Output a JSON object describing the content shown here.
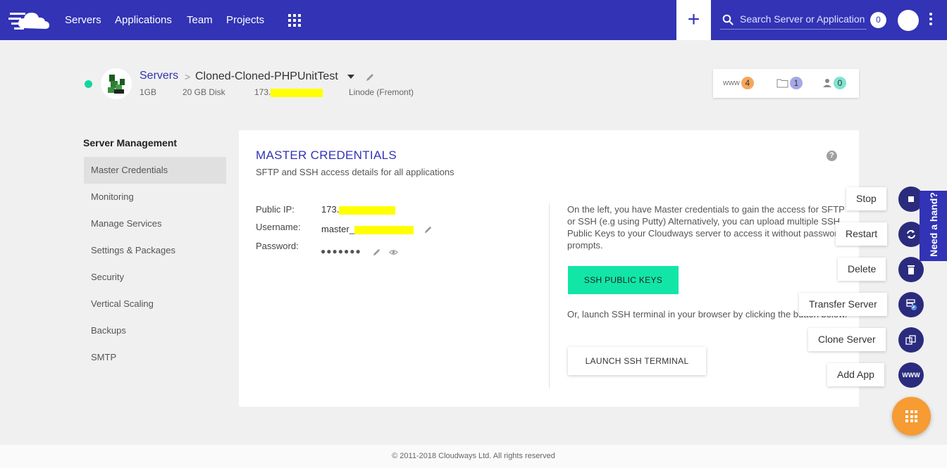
{
  "nav": {
    "links": [
      "Servers",
      "Applications",
      "Team",
      "Projects"
    ],
    "plus": "+",
    "search_placeholder": "Search Server or Application",
    "notifications": "0"
  },
  "server": {
    "breadcrumb_root": "Servers",
    "breadcrumb_sep": ">",
    "name": "Cloned-Cloned-PHPUnitTest",
    "ram": "1GB",
    "disk": "20 GB Disk",
    "ip_prefix": "173.",
    "provider": "Linode (Fremont)",
    "counters": {
      "www_label": "www",
      "www_count": "4",
      "folders_count": "1",
      "users_count": "0"
    }
  },
  "menu": {
    "title": "Server Management",
    "items": [
      "Master Credentials",
      "Monitoring",
      "Manage Services",
      "Settings & Packages",
      "Security",
      "Vertical Scaling",
      "Backups",
      "SMTP"
    ],
    "active": "Master Credentials"
  },
  "credentials": {
    "title": "MASTER CREDENTIALS",
    "subtitle": "SFTP and SSH access details for all applications",
    "help": "?",
    "ip_label": "Public IP:",
    "ip_value": "173.",
    "username_label": "Username:",
    "username_value": "master_",
    "password_label": "Password:",
    "password_mask": "●●●●●●●",
    "info_text": "On the left, you have Master credentials to gain the access for SFTP or SSH (e.g using Putty) Alternatively, you can upload multiple SSH Public Keys to your Cloudways server to access it without password prompts.",
    "ssh_keys_button": "SSH PUBLIC KEYS",
    "terminal_text": "Or, launch SSH terminal in your browser by clicking the button below.",
    "terminal_button": "LAUNCH SSH TERMINAL"
  },
  "actions": {
    "stop": "Stop",
    "restart": "Restart",
    "delete": "Delete",
    "transfer": "Transfer Server",
    "clone": "Clone Server",
    "add_app": "Add App",
    "www_icon_text": "WWW"
  },
  "help_tab": "Need a hand?",
  "footer": "© 2011-2018 Cloudways Ltd. All rights reserved",
  "colors": {
    "brand": "#3233b5",
    "accent_green": "#12e6a6",
    "fab_orange": "#f79b33",
    "status_green": "#10d89c",
    "highlight": "#ffff00"
  }
}
